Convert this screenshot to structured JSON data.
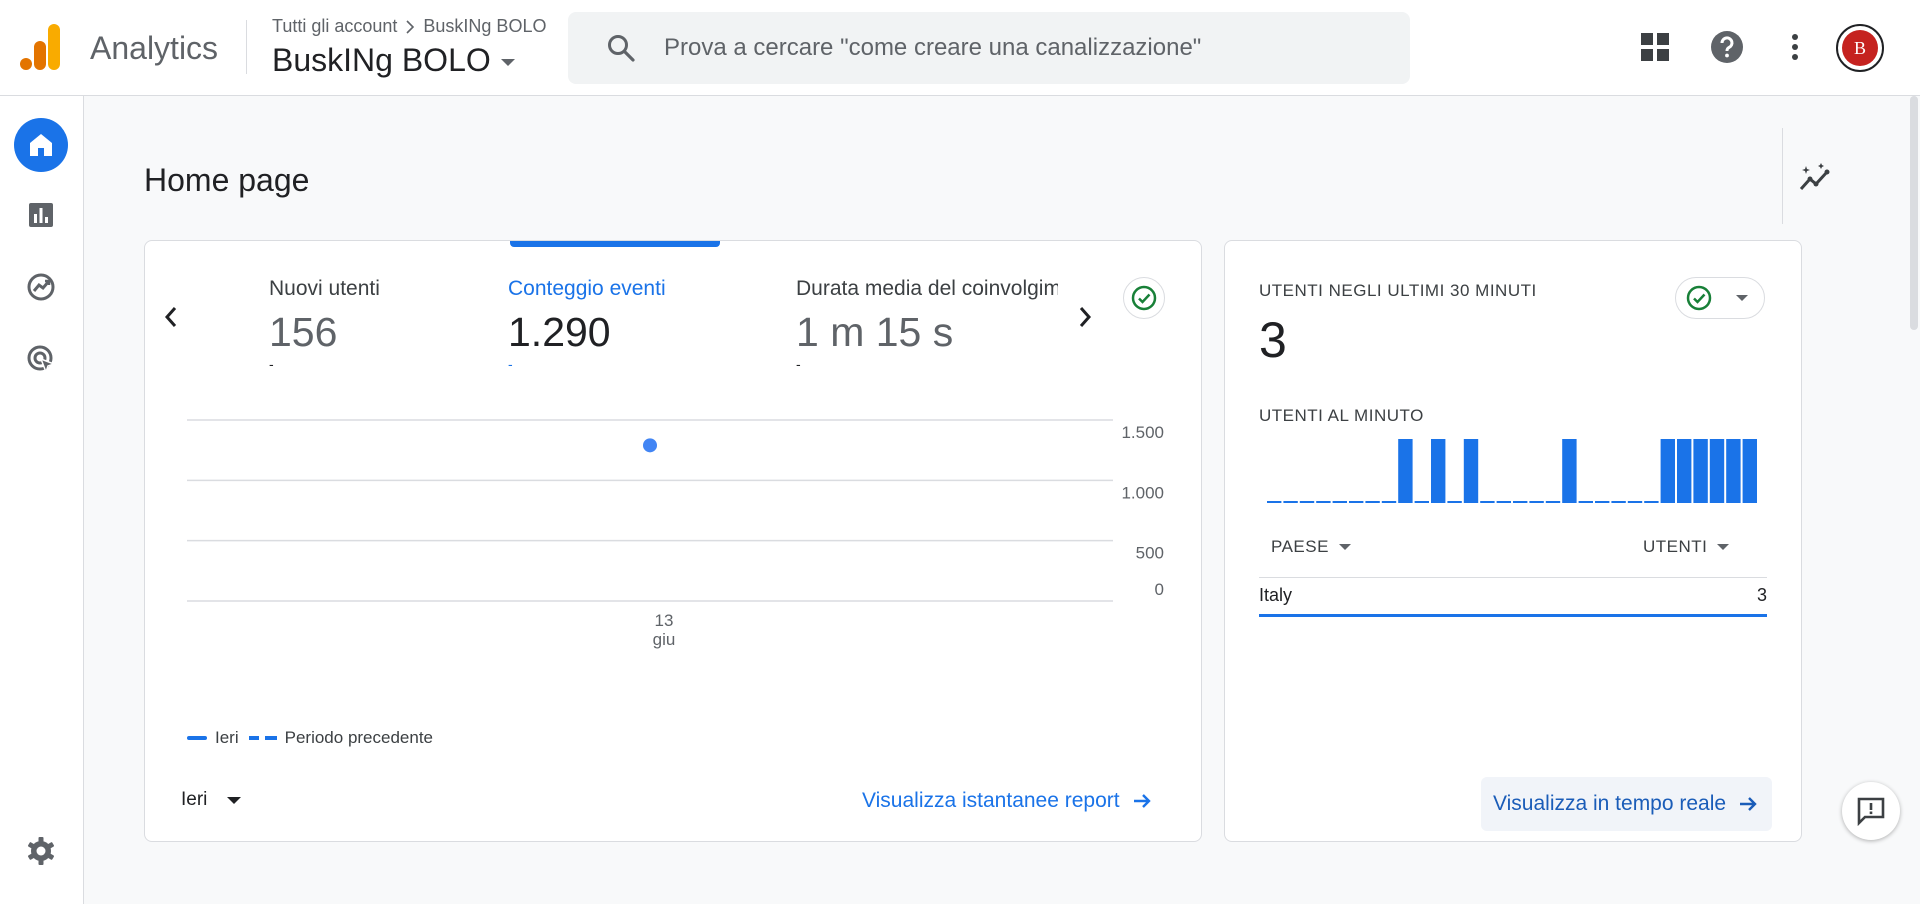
{
  "header": {
    "app_name": "Analytics",
    "breadcrumb": {
      "account": "Tutti gli account",
      "property": "BuskINg BOLO"
    },
    "property_name": "BuskINg BOLO",
    "search_placeholder": "Prova a cercare \"come creare una canalizzazione\"",
    "icons": [
      "apps-grid-icon",
      "help-icon",
      "more-vert-icon"
    ],
    "avatar_initials": "B"
  },
  "nav": {
    "items": [
      "home-icon",
      "reports-icon",
      "explore-icon",
      "advertising-icon"
    ],
    "active": "home-icon",
    "bottom": "settings-icon"
  },
  "page": {
    "title": "Home page"
  },
  "overview": {
    "metrics": [
      {
        "label": "Nuovi utenti",
        "value": "156",
        "delta": "-"
      },
      {
        "label": "Conteggio eventi",
        "value": "1.290",
        "delta": "-",
        "selected": true
      },
      {
        "label": "Durata media del coinvolgimento",
        "value": "1 m 15 s",
        "delta": "-"
      }
    ],
    "legend": {
      "current": "Ieri",
      "previous": "Periodo precedente"
    },
    "date_range": "Ieri",
    "report_link": "Visualizza istantanee report"
  },
  "chart_data": {
    "type": "scatter",
    "x": [
      "13 giu"
    ],
    "series": [
      {
        "name": "Ieri",
        "values": [
          1290
        ]
      }
    ],
    "y_ticks": [
      "1.500",
      "1.000",
      "500",
      "0"
    ],
    "x_tick_label": {
      "day": "13",
      "month": "giu"
    },
    "ylim": [
      0,
      1500
    ],
    "grid": true,
    "legend_position": "bottom-left"
  },
  "realtime": {
    "title": "UTENTI NEGLI ULTIMI 30 MINUTI",
    "value": "3",
    "subtitle": "UTENTI AL MINUTO",
    "per_minute": [
      0,
      0,
      0,
      0,
      0,
      0,
      0,
      0,
      1,
      0,
      1,
      0,
      1,
      0,
      0,
      0,
      0,
      0,
      1,
      0,
      0,
      0,
      0,
      0,
      1,
      1,
      1,
      1,
      1,
      1
    ],
    "table": {
      "columns": [
        "PAESE",
        "UTENTI"
      ],
      "rows": [
        {
          "country": "Italy",
          "users": "3"
        }
      ]
    },
    "link": "Visualizza in tempo reale"
  },
  "colors": {
    "accent": "#1a73e8",
    "logo_orange": "#f9ab00",
    "logo_dark_orange": "#e37400",
    "success": "#188038"
  }
}
